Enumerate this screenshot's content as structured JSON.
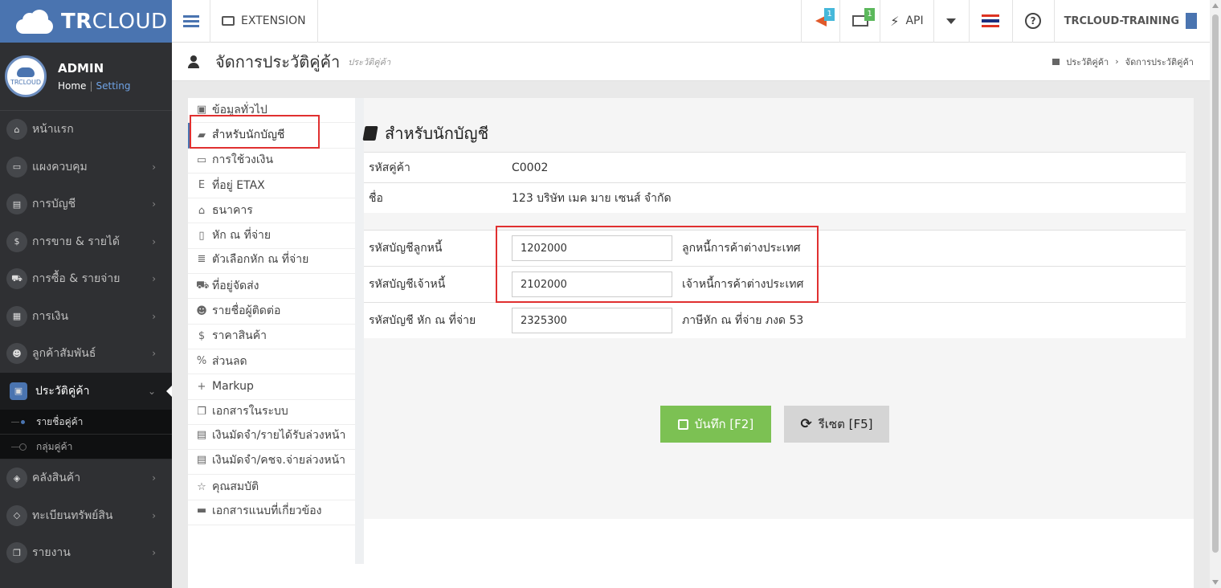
{
  "app": {
    "brand_bold": "TR",
    "brand_light": "CLOUD"
  },
  "topbar": {
    "menu_icon": "hamburger-icon",
    "extension_label": "EXTENSION",
    "notifications_badge": "1",
    "messages_badge": "1",
    "api_label": "API",
    "company": "TRCLOUD-TRAINING",
    "help_glyph": "?"
  },
  "user": {
    "name": "ADMIN",
    "home": "Home",
    "sep": "|",
    "setting": "Setting",
    "avatar_text": "TRCLOUD"
  },
  "sidebar": {
    "items": [
      {
        "label": "หน้าแรก",
        "icon": "home-icon",
        "glyph": "⌂",
        "chevron": ""
      },
      {
        "label": "แผงควบคุม",
        "icon": "monitor-icon",
        "glyph": "▭",
        "chevron": "›"
      },
      {
        "label": "การบัญชี",
        "icon": "book-icon",
        "glyph": "▤",
        "chevron": "›"
      },
      {
        "label": "การขาย & รายได้",
        "icon": "dollar-icon",
        "glyph": "$",
        "chevron": "›"
      },
      {
        "label": "การซื้อ & รายจ่าย",
        "icon": "cart-icon",
        "glyph": "⛟",
        "chevron": "›"
      },
      {
        "label": "การเงิน",
        "icon": "calendar-icon",
        "glyph": "▦",
        "chevron": "›"
      },
      {
        "label": "ลูกค้าสัมพันธ์",
        "icon": "group-icon",
        "glyph": "☻",
        "chevron": "›"
      }
    ],
    "active": {
      "label": "ประวัติคู่ค้า",
      "icon": "contact-card-icon",
      "glyph": "▣",
      "chevron": "⌄"
    },
    "sub_items": [
      {
        "label": "รายชื่อคู่ค้า"
      },
      {
        "label": "กลุ่มคู่ค้า"
      }
    ],
    "items_after": [
      {
        "label": "คลังสินค้า",
        "icon": "cubes-icon",
        "glyph": "◈",
        "chevron": "›"
      },
      {
        "label": "ทะเบียนทรัพย์สิน",
        "icon": "diamond-icon",
        "glyph": "◇",
        "chevron": "›"
      },
      {
        "label": "รายงาน",
        "icon": "copy-icon",
        "glyph": "❐",
        "chevron": "›"
      }
    ]
  },
  "page": {
    "title": "จัดการประวัติคู่ค้า",
    "subtitle": "ประวัติคู่ค้า",
    "breadcrumb": [
      "ประวัติคู่ค้า",
      "จัดการประวัติคู่ค้า"
    ],
    "breadcrumb_sep": "›"
  },
  "tabs": [
    {
      "label": "ข้อมูลทั่วไป",
      "icon": "contact-card-icon",
      "glyph": "▣"
    },
    {
      "label": "สำหรับนักบัญชี",
      "icon": "book-icon",
      "glyph": "▰"
    },
    {
      "label": "การใช้วงเงิน",
      "icon": "credit-card-icon",
      "glyph": "▭"
    },
    {
      "label": "ที่อยู่ ETAX",
      "icon": "etax-icon",
      "glyph": "E"
    },
    {
      "label": "ธนาคาร",
      "icon": "bank-icon",
      "glyph": "⌂"
    },
    {
      "label": "หัก ณ ที่จ่าย",
      "icon": "word-file-icon",
      "glyph": "▯"
    },
    {
      "label": "ตัวเลือกหัก ณ ที่จ่าย",
      "icon": "list-icon",
      "glyph": "≣"
    },
    {
      "label": "ที่อยู่จัดส่ง",
      "icon": "truck-icon",
      "glyph": "⛟"
    },
    {
      "label": "รายชื่อผู้ติดต่อ",
      "icon": "users-icon",
      "glyph": "☻"
    },
    {
      "label": "ราคาสินค้า",
      "icon": "dollar-icon",
      "glyph": "$"
    },
    {
      "label": "ส่วนลด",
      "icon": "percent-icon",
      "glyph": "%"
    },
    {
      "label": "Markup",
      "icon": "plus-icon",
      "glyph": "+"
    },
    {
      "label": "เอกสารในระบบ",
      "icon": "copy-icon",
      "glyph": "❐"
    },
    {
      "label": "เงินมัดจำ/รายได้รับล่วงหน้า",
      "icon": "file-text-icon",
      "glyph": "▤"
    },
    {
      "label": "เงินมัดจำ/คชจ.จ่ายล่วงหน้า",
      "icon": "file-text-icon",
      "glyph": "▤"
    },
    {
      "label": "คุณสมบัติ",
      "icon": "star-icon",
      "glyph": "☆"
    },
    {
      "label": "เอกสารแนบที่เกี่ยวข้อง",
      "icon": "folder-icon",
      "glyph": "▬"
    }
  ],
  "panel": {
    "title": "สำหรับนักบัญชี",
    "info": [
      {
        "label": "รหัสคู่ค้า",
        "value": "C0002"
      },
      {
        "label": "ชื่อ",
        "value": "123 บริษัท เมค มาย เซนส์ จำกัด"
      }
    ],
    "accounts": [
      {
        "label": "รหัสบัญชีลูกหนี้",
        "value": "1202000",
        "desc": "ลูกหนี้การค้าต่างประเทศ"
      },
      {
        "label": "รหัสบัญชีเจ้าหนี้",
        "value": "2102000",
        "desc": "เจ้าหนี้การค้าต่างประเทศ"
      },
      {
        "label": "รหัสบัญชี หัก ณ ที่จ่าย",
        "value": "2325300",
        "desc": "ภาษีหัก ณ ที่จ่าย ภงด 53"
      }
    ],
    "save_label": "บันทึก [F2]",
    "reset_label": "รีเซต [F5]"
  },
  "colors": {
    "brand": "#4a74b0",
    "sidebar": "#2f3033",
    "save": "#7cc153",
    "highlight": "#e03030"
  }
}
